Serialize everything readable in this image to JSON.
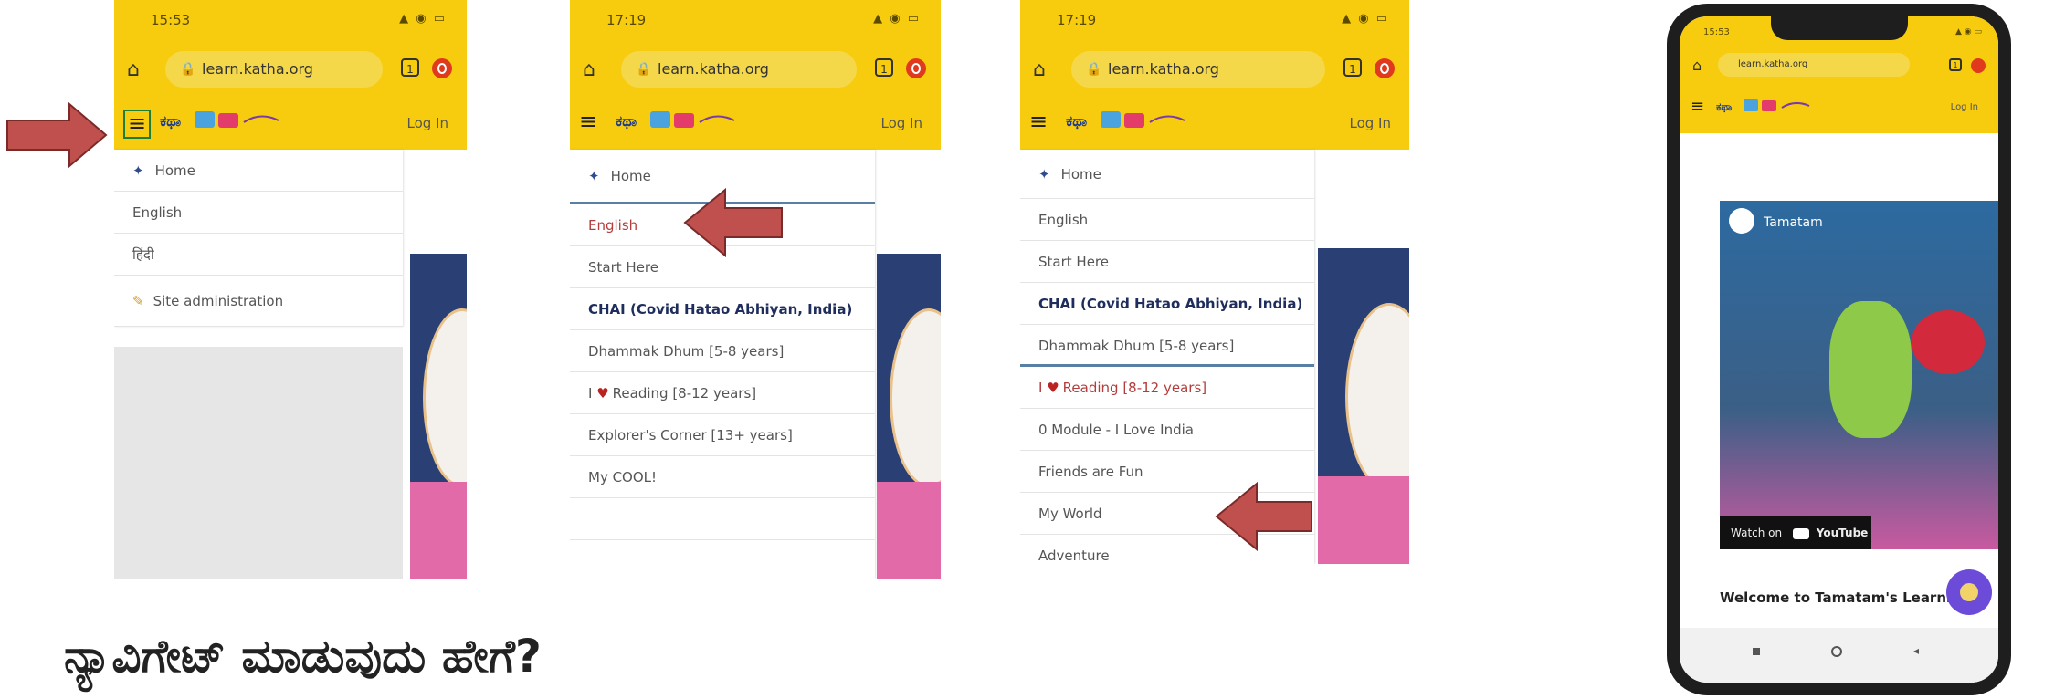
{
  "colors": {
    "brand_yellow": "#f7cc0f",
    "arrow_red": "#c0504d",
    "heading": "#1f2d5c"
  },
  "caption": "ನ್ಯಾವಿಗೇಟ್ ಮಾಡುವುದು ಹೇಗೆ?",
  "screen1": {
    "time": "15:53",
    "url": "learn.katha.org",
    "tab_count": "1",
    "login": "Log In",
    "menu": {
      "home": "Home",
      "english": "English",
      "hindi": "हिंदी",
      "site_admin": "Site administration"
    }
  },
  "screen2": {
    "time": "17:19",
    "url": "learn.katha.org",
    "tab_count": "1",
    "login": "Log In",
    "menu": {
      "home": "Home",
      "english": "English",
      "start_here": "Start Here",
      "chai": "CHAI (Covid Hatao Abhiyan, India)",
      "dhammak": "Dhammak Dhum [5-8 years]",
      "reading_pre": "I",
      "reading": "Reading [8-12 years]",
      "explorer": "Explorer's Corner [13+ years]",
      "cool": "My COOL!"
    }
  },
  "screen3": {
    "time": "17:19",
    "url": "learn.katha.org",
    "tab_count": "1",
    "login": "Log In",
    "menu": {
      "home": "Home",
      "english": "English",
      "start_here": "Start Here",
      "chai": "CHAI (Covid Hatao Abhiyan, India)",
      "dhammak": "Dhammak Dhum [5-8 years]",
      "reading_pre": "I",
      "reading": "Reading [8-12 years]",
      "module": "0 Module - I Love India",
      "friends": "Friends are Fun",
      "world": "My World",
      "adventure": "Adventure"
    }
  },
  "phone": {
    "time": "15:53",
    "url": "learn.katha.org",
    "tab_count": "1",
    "login": "Log In",
    "channel": "Tamatam",
    "watch_on": "Watch on",
    "youtube": "YouTube",
    "welcome": "Welcome to Tamatam's Learnin"
  }
}
